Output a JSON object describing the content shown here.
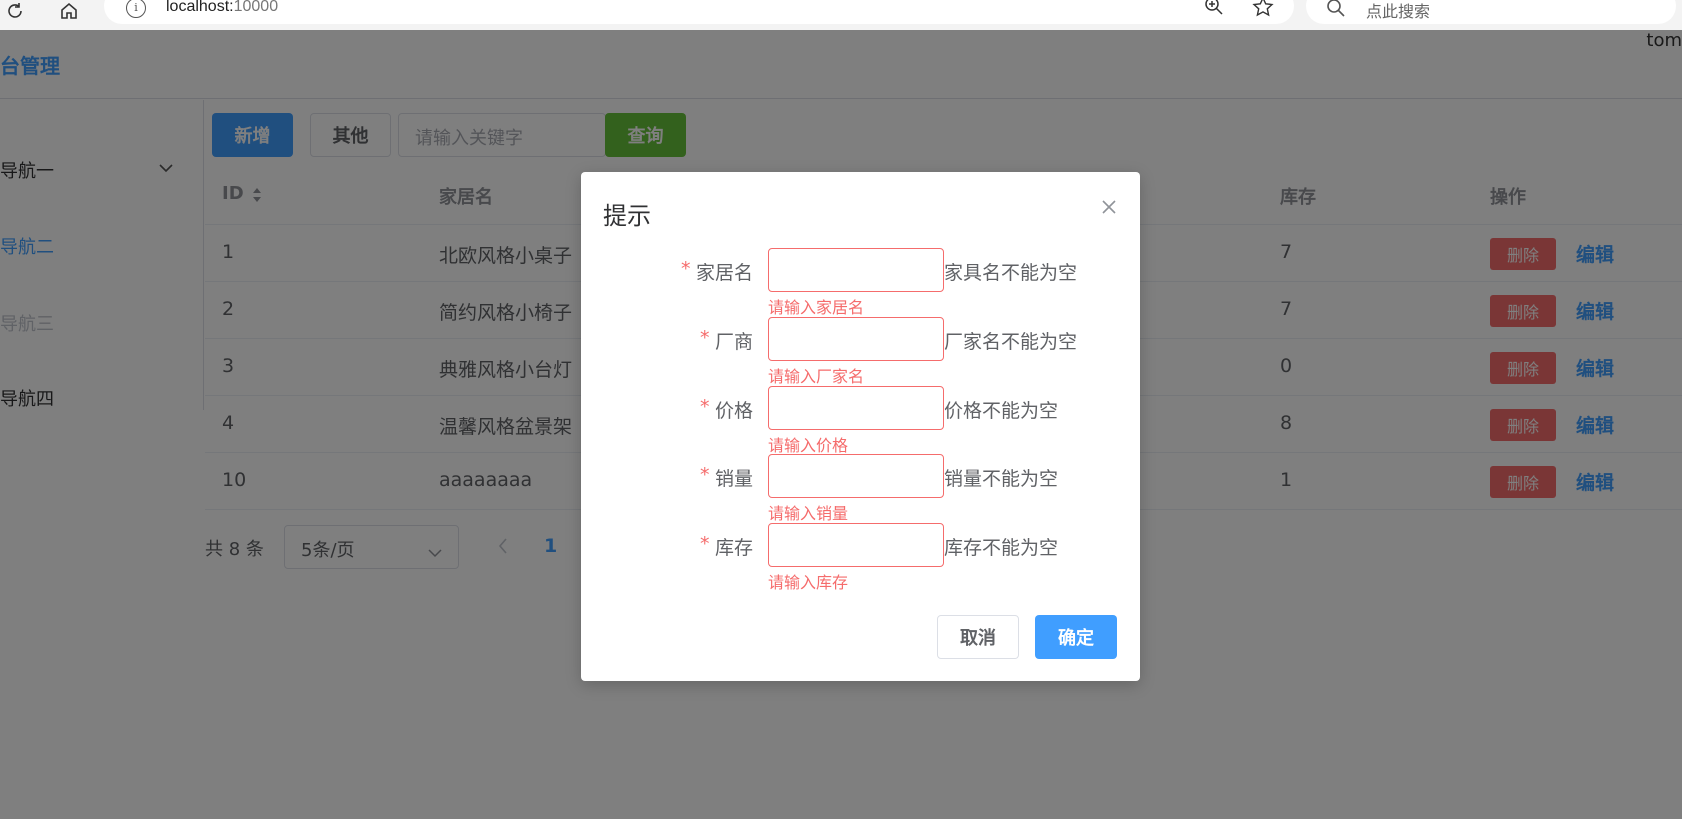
{
  "browser": {
    "address_host": "localhost:",
    "address_port": "10000",
    "search_placeholder": "点此搜索"
  },
  "app": {
    "title": "台管理",
    "user": "tom"
  },
  "sidebar": {
    "items": [
      {
        "label": "导航一",
        "state": "normal"
      },
      {
        "label": "导航二",
        "state": "active"
      },
      {
        "label": "导航三",
        "state": "disabled"
      },
      {
        "label": "导航四",
        "state": "normal"
      }
    ]
  },
  "toolbar": {
    "add_label": "新增",
    "other_label": "其他",
    "keyword_placeholder": "请输入关键字",
    "query_label": "查询"
  },
  "table": {
    "columns": {
      "id": "ID",
      "name": "家居名",
      "stock": "库存",
      "ops": "操作"
    },
    "rows": [
      {
        "id": "1",
        "name": "北欧风格小桌子",
        "stock": "7"
      },
      {
        "id": "2",
        "name": "简约风格小椅子",
        "stock": "7"
      },
      {
        "id": "3",
        "name": "典雅风格小台灯",
        "stock": "0"
      },
      {
        "id": "4",
        "name": "温馨风格盆景架",
        "stock": "8"
      },
      {
        "id": "10",
        "name": "aaaaaaaa",
        "stock": "1"
      }
    ],
    "delete_label": "删除",
    "edit_label": "编辑"
  },
  "pagination": {
    "total": "共 8 条",
    "page_size": "5条/页",
    "current_page": "1"
  },
  "dialog": {
    "title": "提示",
    "fields": [
      {
        "label": "家居名",
        "hint": "家具名不能为空",
        "error": "请输入家居名"
      },
      {
        "label": "厂商",
        "hint": "厂家名不能为空",
        "error": "请输入厂家名"
      },
      {
        "label": "价格",
        "hint": "价格不能为空",
        "error": "请输入价格"
      },
      {
        "label": "销量",
        "hint": "销量不能为空",
        "error": "请输入销量"
      },
      {
        "label": "库存",
        "hint": "库存不能为空",
        "error": "请输入库存"
      }
    ],
    "cancel_label": "取消",
    "ok_label": "确定"
  },
  "colors": {
    "primary": "#409eff",
    "success": "#67c23a",
    "danger": "#f56c6c"
  }
}
